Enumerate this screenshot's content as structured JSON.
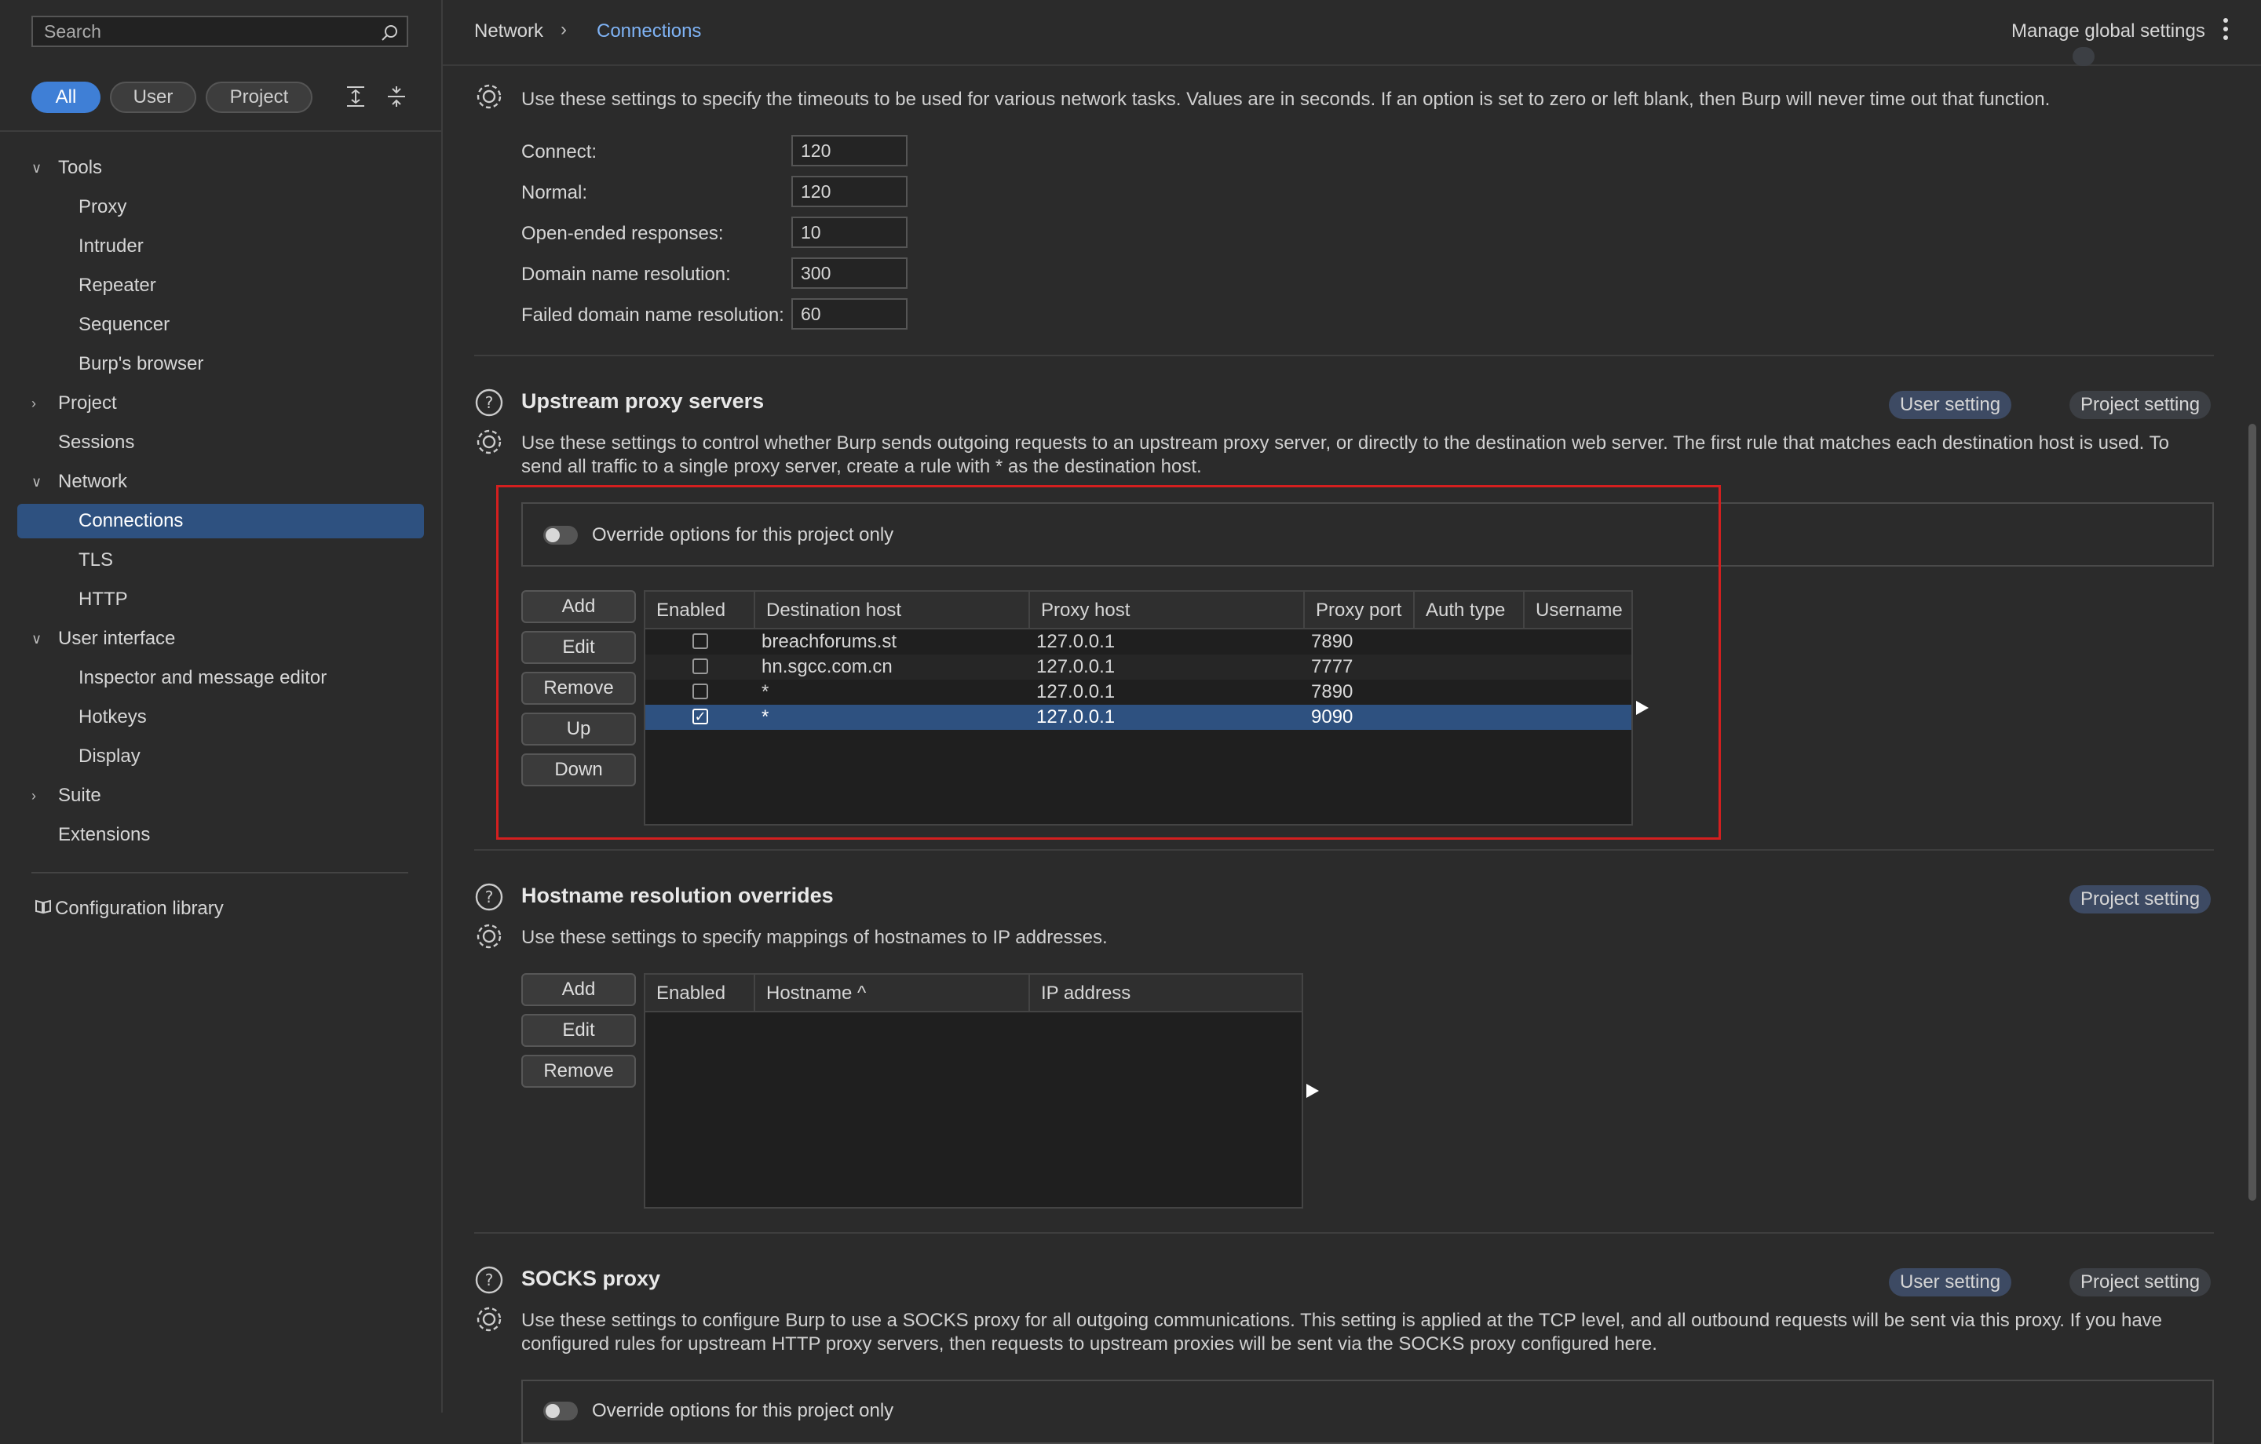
{
  "sidebar": {
    "search_placeholder": "Search",
    "filters": [
      "All",
      "User",
      "Project"
    ],
    "items": [
      {
        "label": "Tools",
        "chev": "v"
      },
      {
        "label": "Proxy"
      },
      {
        "label": "Intruder"
      },
      {
        "label": "Repeater"
      },
      {
        "label": "Sequencer"
      },
      {
        "label": "Burp's browser"
      },
      {
        "label": "Project",
        "chev": ">"
      },
      {
        "label": "Sessions"
      },
      {
        "label": "Network",
        "chev": "v"
      },
      {
        "label": "Connections"
      },
      {
        "label": "TLS"
      },
      {
        "label": "HTTP"
      },
      {
        "label": "User interface",
        "chev": "v"
      },
      {
        "label": "Inspector and message editor"
      },
      {
        "label": "Hotkeys"
      },
      {
        "label": "Display"
      },
      {
        "label": "Suite",
        "chev": ">"
      },
      {
        "label": "Extensions"
      }
    ],
    "config_library": "Configuration library"
  },
  "header": {
    "crumb_root": "Network",
    "crumb_sep": "›",
    "crumb_current": "Connections",
    "manage": "Manage global settings"
  },
  "timeouts": {
    "description": "Use these settings to specify the timeouts to be used for various network tasks. Values are in seconds. If an option is set to zero or left blank, then Burp will never time out that function.",
    "fields": [
      {
        "label": "Connect:",
        "value": "120"
      },
      {
        "label": "Normal:",
        "value": "120"
      },
      {
        "label": "Open-ended responses:",
        "value": "10"
      },
      {
        "label": "Domain name resolution:",
        "value": "300"
      },
      {
        "label": "Failed domain name resolution:",
        "value": "60"
      }
    ]
  },
  "upstream": {
    "title": "Upstream proxy servers",
    "badge_user": "User setting",
    "badge_project": "Project setting",
    "description_line1": "Use these settings to control whether Burp sends outgoing requests to an upstream proxy server, or directly to the destination web server. The first rule that matches each destination host is used. To",
    "description_line2": "send all traffic to a single proxy server, create a rule with * as the destination host.",
    "override_label": "Override options for this project only",
    "buttons": [
      "Add",
      "Edit",
      "Remove",
      "Up",
      "Down"
    ],
    "columns": [
      "Enabled",
      "Destination host",
      "Proxy host",
      "Proxy port",
      "Auth type",
      "Username"
    ],
    "rows": [
      {
        "enabled": false,
        "dest": "breachforums.st",
        "proxy_host": "127.0.0.1",
        "port": "7890",
        "auth": "",
        "user": ""
      },
      {
        "enabled": false,
        "dest": "hn.sgcc.com.cn",
        "proxy_host": "127.0.0.1",
        "port": "7777",
        "auth": "",
        "user": ""
      },
      {
        "enabled": false,
        "dest": "*",
        "proxy_host": "127.0.0.1",
        "port": "7890",
        "auth": "",
        "user": ""
      },
      {
        "enabled": true,
        "dest": "*",
        "proxy_host": "127.0.0.1",
        "port": "9090",
        "auth": "",
        "user": ""
      }
    ]
  },
  "hostname": {
    "title": "Hostname resolution overrides",
    "badge_project": "Project setting",
    "description": "Use these settings to specify mappings of hostnames to IP addresses.",
    "buttons": [
      "Add",
      "Edit",
      "Remove"
    ],
    "columns": [
      "Enabled",
      "Hostname ^",
      "IP address"
    ]
  },
  "socks": {
    "title": "SOCKS proxy",
    "badge_user": "User setting",
    "badge_project": "Project setting",
    "description_line1": "Use these settings to configure Burp to use a SOCKS proxy for all outgoing communications. This setting is applied at the TCP level, and all outbound requests will be sent via this proxy. If you have",
    "description_line2": "configured rules for upstream HTTP proxy servers, then requests to upstream proxies will be sent via the SOCKS proxy configured here.",
    "override_label": "Override options for this project only"
  },
  "colors": {
    "accent": "#3f7fd6",
    "selection": "#2e5180",
    "highlight_box": "#d41f1f"
  }
}
